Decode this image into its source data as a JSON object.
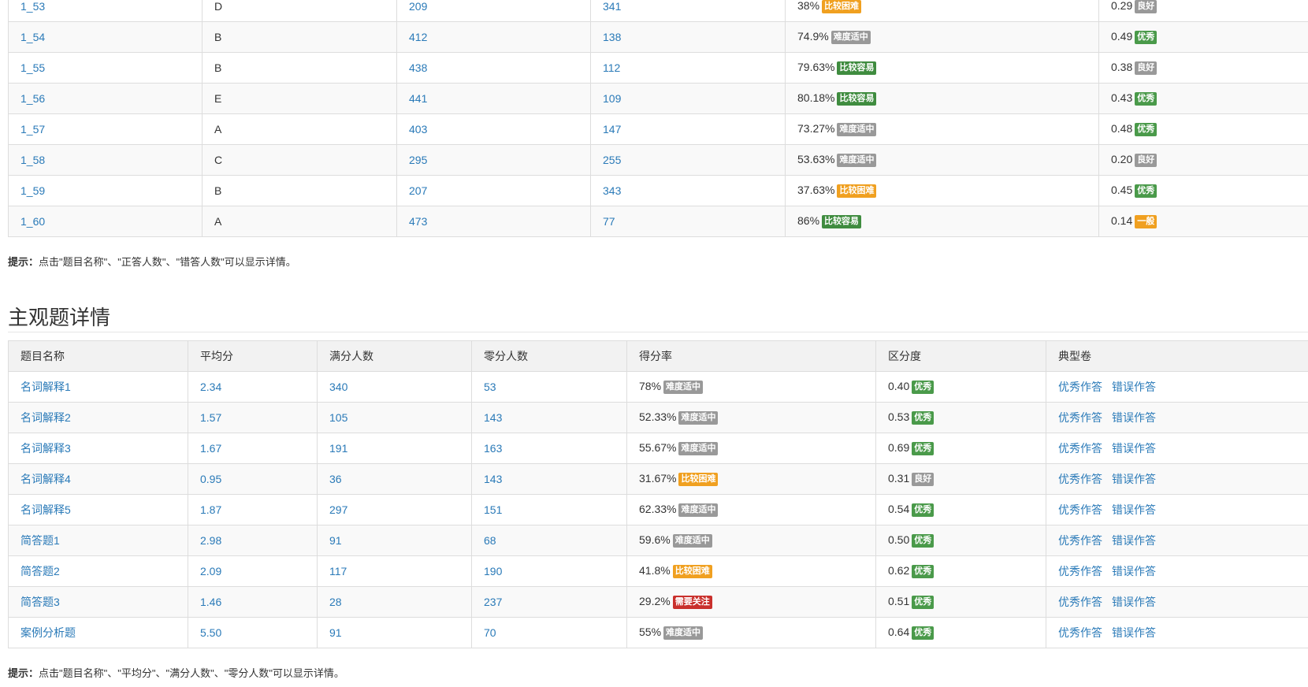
{
  "objective": {
    "rows": [
      {
        "name": "1_53",
        "answer": "D",
        "correct": "209",
        "wrong": "341",
        "rate": "38%",
        "difficulty": "比较困难",
        "diff_color": "#f0a020",
        "disc": "0.29",
        "disc_label": "良好",
        "disc_color": "#999999"
      },
      {
        "name": "1_54",
        "answer": "B",
        "correct": "412",
        "wrong": "138",
        "rate": "74.9%",
        "difficulty": "难度适中",
        "diff_color": "#999999",
        "disc": "0.49",
        "disc_label": "优秀",
        "disc_color": "#4a9a4a"
      },
      {
        "name": "1_55",
        "answer": "B",
        "correct": "438",
        "wrong": "112",
        "rate": "79.63%",
        "difficulty": "比较容易",
        "diff_color": "#3f8c3f",
        "disc": "0.38",
        "disc_label": "良好",
        "disc_color": "#999999"
      },
      {
        "name": "1_56",
        "answer": "E",
        "correct": "441",
        "wrong": "109",
        "rate": "80.18%",
        "difficulty": "比较容易",
        "diff_color": "#3f8c3f",
        "disc": "0.43",
        "disc_label": "优秀",
        "disc_color": "#4a9a4a"
      },
      {
        "name": "1_57",
        "answer": "A",
        "correct": "403",
        "wrong": "147",
        "rate": "73.27%",
        "difficulty": "难度适中",
        "diff_color": "#999999",
        "disc": "0.48",
        "disc_label": "优秀",
        "disc_color": "#4a9a4a"
      },
      {
        "name": "1_58",
        "answer": "C",
        "correct": "295",
        "wrong": "255",
        "rate": "53.63%",
        "difficulty": "难度适中",
        "diff_color": "#999999",
        "disc": "0.20",
        "disc_label": "良好",
        "disc_color": "#999999"
      },
      {
        "name": "1_59",
        "answer": "B",
        "correct": "207",
        "wrong": "343",
        "rate": "37.63%",
        "difficulty": "比较困难",
        "diff_color": "#f0a020",
        "disc": "0.45",
        "disc_label": "优秀",
        "disc_color": "#4a9a4a"
      },
      {
        "name": "1_60",
        "answer": "A",
        "correct": "473",
        "wrong": "77",
        "rate": "86%",
        "difficulty": "比较容易",
        "diff_color": "#3f8c3f",
        "disc": "0.14",
        "disc_label": "一般",
        "disc_color": "#f0a020"
      }
    ],
    "hint_label": "提示：",
    "hint_text": "点击\"题目名称\"、\"正答人数\"、\"错答人数\"可以显示详情。"
  },
  "subjective": {
    "title": "主观题详情",
    "headers": [
      "题目名称",
      "平均分",
      "满分人数",
      "零分人数",
      "得分率",
      "区分度",
      "典型卷"
    ],
    "rows": [
      {
        "name": "名词解释1",
        "avg": "2.34",
        "full": "340",
        "zero": "53",
        "rate": "78%",
        "difficulty": "难度适中",
        "diff_color": "#999999",
        "disc": "0.40",
        "disc_label": "优秀",
        "disc_color": "#4a9a4a"
      },
      {
        "name": "名词解释2",
        "avg": "1.57",
        "full": "105",
        "zero": "143",
        "rate": "52.33%",
        "difficulty": "难度适中",
        "diff_color": "#999999",
        "disc": "0.53",
        "disc_label": "优秀",
        "disc_color": "#4a9a4a"
      },
      {
        "name": "名词解释3",
        "avg": "1.67",
        "full": "191",
        "zero": "163",
        "rate": "55.67%",
        "difficulty": "难度适中",
        "diff_color": "#999999",
        "disc": "0.69",
        "disc_label": "优秀",
        "disc_color": "#4a9a4a"
      },
      {
        "name": "名词解释4",
        "avg": "0.95",
        "full": "36",
        "zero": "143",
        "rate": "31.67%",
        "difficulty": "比较困难",
        "diff_color": "#f0a020",
        "disc": "0.31",
        "disc_label": "良好",
        "disc_color": "#999999"
      },
      {
        "name": "名词解释5",
        "avg": "1.87",
        "full": "297",
        "zero": "151",
        "rate": "62.33%",
        "difficulty": "难度适中",
        "diff_color": "#999999",
        "disc": "0.54",
        "disc_label": "优秀",
        "disc_color": "#4a9a4a"
      },
      {
        "name": "简答题1",
        "avg": "2.98",
        "full": "91",
        "zero": "68",
        "rate": "59.6%",
        "difficulty": "难度适中",
        "diff_color": "#999999",
        "disc": "0.50",
        "disc_label": "优秀",
        "disc_color": "#4a9a4a"
      },
      {
        "name": "简答题2",
        "avg": "2.09",
        "full": "117",
        "zero": "190",
        "rate": "41.8%",
        "difficulty": "比较困难",
        "diff_color": "#f0a020",
        "disc": "0.62",
        "disc_label": "优秀",
        "disc_color": "#4a9a4a"
      },
      {
        "name": "简答题3",
        "avg": "1.46",
        "full": "28",
        "zero": "237",
        "rate": "29.2%",
        "difficulty": "需要关注",
        "diff_color": "#c9302c",
        "disc": "0.51",
        "disc_label": "优秀",
        "disc_color": "#4a9a4a"
      },
      {
        "name": "案例分析题",
        "avg": "5.50",
        "full": "91",
        "zero": "70",
        "rate": "55%",
        "difficulty": "难度适中",
        "diff_color": "#999999",
        "disc": "0.64",
        "disc_label": "优秀",
        "disc_color": "#4a9a4a"
      }
    ],
    "link_good": "优秀作答",
    "link_bad": "错误作答",
    "hint_label": "提示：",
    "hint_text": "点击\"题目名称\"、\"平均分\"、\"满分人数\"、\"零分人数\"可以显示详情。"
  }
}
